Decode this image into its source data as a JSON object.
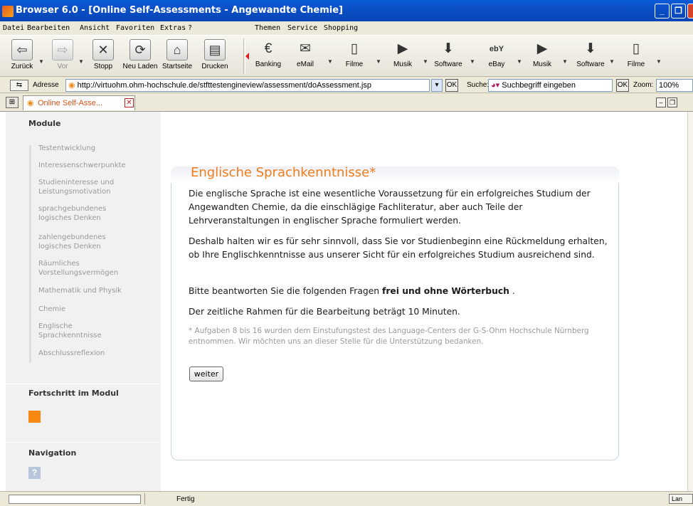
{
  "window": {
    "title": "Browser 6.0 - [Online Self-Assessments - Angewandte Chemie]"
  },
  "menu": {
    "left": [
      "Datei",
      "Bearbeiten",
      "Ansicht",
      "Favoriten",
      "Extras",
      "?"
    ],
    "right": [
      "Themen",
      "Service",
      "Shopping"
    ]
  },
  "toolbar": {
    "nav": [
      {
        "label": "Zurück",
        "icon": "back-arrow-icon"
      },
      {
        "label": "Vor",
        "icon": "forward-arrow-icon"
      },
      {
        "label": "Stopp",
        "icon": "stop-icon"
      },
      {
        "label": "Neu Laden",
        "icon": "reload-icon"
      },
      {
        "label": "Startseite",
        "icon": "home-icon"
      },
      {
        "label": "Drucken",
        "icon": "printer-icon"
      }
    ],
    "links": [
      {
        "label": "Banking",
        "icon": "euro-icon"
      },
      {
        "label": "eMail",
        "icon": "envelope-icon"
      },
      {
        "label": "Filme",
        "icon": "film-icon"
      },
      {
        "label": "Musik",
        "icon": "play-icon"
      },
      {
        "label": "Software",
        "icon": "download-icon"
      },
      {
        "label": "eBay",
        "icon": "ebay-icon",
        "glyph": "ebY"
      },
      {
        "label": "Musik",
        "icon": "play-icon"
      },
      {
        "label": "Software",
        "icon": "download-icon"
      },
      {
        "label": "Filme",
        "icon": "film-icon"
      }
    ]
  },
  "addressbar": {
    "label": "Adresse",
    "url": "http://virtuohm.ohm-hochschule.de/stfttestengineview/assessment/doAssessment.jsp",
    "ok": "OK",
    "search_label": "Suche:",
    "search_placeholder": "Suchbegriff eingeben",
    "search_ok": "OK",
    "zoom_label": "Zoom:",
    "zoom_value": "100%"
  },
  "tab": {
    "title": "Online Self-Asse..."
  },
  "sidebar": {
    "module_heading": "Module",
    "items": [
      "Testentwicklung",
      "Interessenschwerpunkte",
      "Studieninteresse und\nLeistungsmotivation",
      "sprachgebundenes\nlogisches Denken",
      "zahlengebundenes\nlogisches Denken",
      "Räumliches\nVorstellungsvermögen",
      "Mathematik und Physik",
      "Chemie",
      "Englische\nSprachkenntnisse",
      "Abschlussreflexion"
    ],
    "progress_heading": "Fortschritt im Modul",
    "progress": {
      "completed": 1,
      "color": "#f7870f"
    },
    "navigation_heading": "Navigation",
    "help_icon": "?"
  },
  "content": {
    "title": "Englische Sprachkenntnisse*",
    "p1": "Die englische Sprache ist eine wesentliche Voraussetzung für ein erfolgreiches Studium der Angewandten Chemie, da die einschlägige Fachliteratur, aber auch Teile der Lehrveranstaltungen in englischer Sprache formuliert werden.",
    "p2": "Deshalb halten wir es für sehr sinnvoll, dass Sie vor Studienbeginn eine Rückmeldung erhalten, ob Ihre Englischkenntnisse aus unserer Sicht für ein erfolgreiches Studium ausreichend sind.",
    "p3_pre": "Bitte beantworten Sie die folgenden Fragen ",
    "p3_bold": "frei und ohne Wörterbuch",
    "p3_post": " .",
    "p4": "Der zeitliche Rahmen für die Bearbeitung beträgt 10 Minuten.",
    "footnote": "* Aufgaben 8 bis 16 wurden dem Einstufungstest des Language-Centers der G-S-Ohm Hochschule Nürnberg entnommen. Wir möchten uns an dieser Stelle für die Unterstützung bedanken.",
    "button": "weiter"
  },
  "statusbar": {
    "text": "Fertig",
    "right": "Lan"
  },
  "colors": {
    "accent": "#f07d1a",
    "titlebar": "#0b4fc6"
  }
}
